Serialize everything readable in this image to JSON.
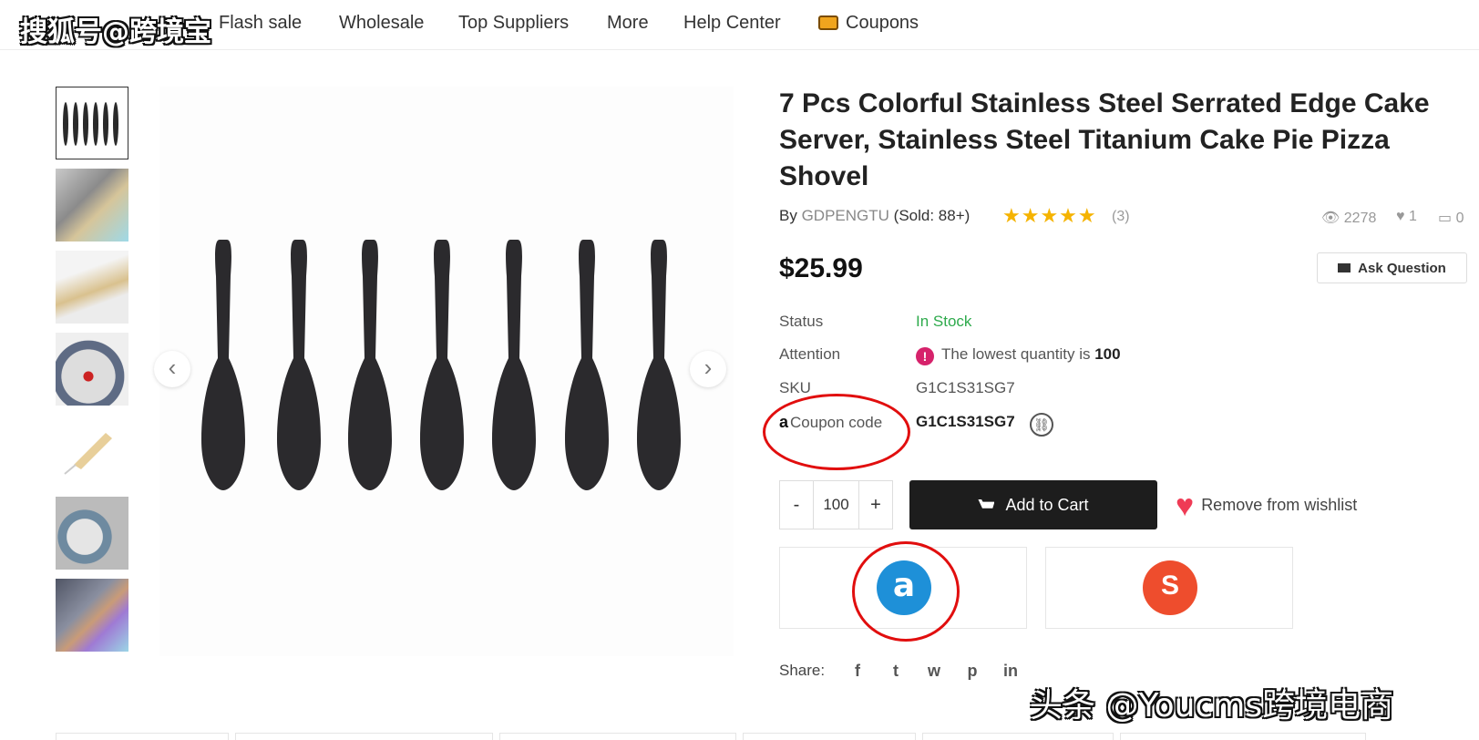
{
  "watermarks": {
    "top_left": "搜狐号@跨境宝",
    "bottom_right": "头条 @Youcms跨境电商"
  },
  "nav": {
    "items": [
      "Flash sale",
      "Wholesale",
      "Top Suppliers",
      "More",
      "Help Center"
    ],
    "coupons": "Coupons",
    "coupons_icon": "coupon-ticket-icon"
  },
  "gallery": {
    "thumbnail_count": 7,
    "prev_icon": "‹",
    "next_icon": "›"
  },
  "product": {
    "title": "7 Pcs Colorful Stainless Steel Serrated Edge Cake Server, Stainless Steel Titanium Cake Pie Pizza Shovel",
    "by_label": "By",
    "seller": "GDPENGTU",
    "sold": "(Sold: 88+)",
    "stars": "★★★★★",
    "rating_value": 5,
    "review_count": "(3)",
    "views": "2278",
    "likes": "1",
    "comments": "0",
    "price": "$25.99",
    "ask_question": "Ask Question"
  },
  "details": {
    "status_label": "Status",
    "status_value": "In Stock",
    "attention_label": "Attention",
    "attention_icon": "!",
    "attention_text": "The lowest quantity is",
    "attention_qty": "100",
    "sku_label": "SKU",
    "sku_value": "G1C1S31SG7",
    "coupon_brand": "a",
    "coupon_label": "Coupon code",
    "coupon_value": "G1C1S31SG7"
  },
  "cart": {
    "minus": "-",
    "quantity": "100",
    "plus": "+",
    "add_to_cart": "Add to Cart",
    "wishlist": "Remove from wishlist",
    "heart": "♥"
  },
  "marketplaces": {
    "amazon_letter": "a",
    "shopee_letter": "S"
  },
  "share": {
    "label": "Share:",
    "icons": [
      "f",
      "t",
      "w",
      "p",
      "in"
    ]
  },
  "colors": {
    "accent_red": "#e10e0e",
    "in_stock": "#2eaa4c",
    "amazon": "#1e90d8",
    "shopee": "#ee4d2d",
    "star": "#f5b301"
  }
}
